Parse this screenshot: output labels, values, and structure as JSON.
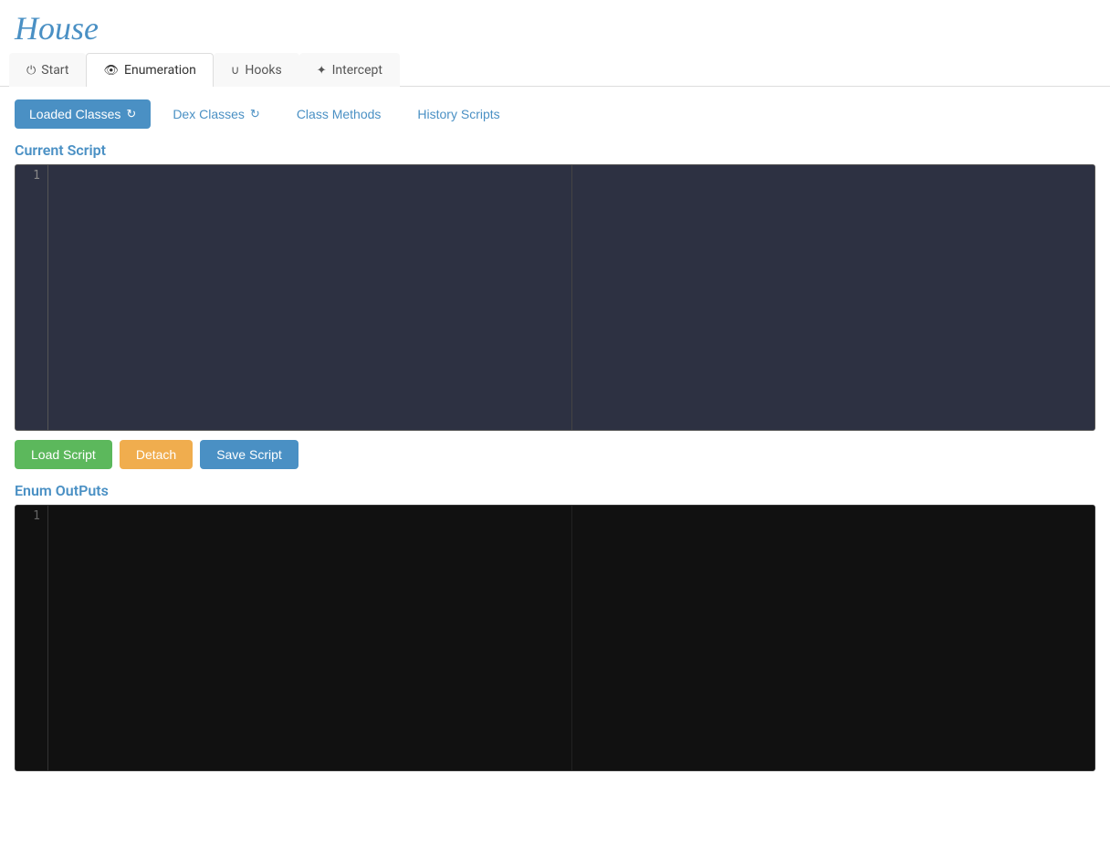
{
  "app": {
    "title": "House"
  },
  "nav": {
    "tabs": [
      {
        "id": "start",
        "label": "Start",
        "icon": "⏻",
        "active": false
      },
      {
        "id": "enumeration",
        "label": "Enumeration",
        "icon": "👁",
        "active": true
      },
      {
        "id": "hooks",
        "label": "Hooks",
        "icon": "Ʉ",
        "active": false
      },
      {
        "id": "intercept",
        "label": "Intercept",
        "icon": "✦",
        "active": false
      }
    ]
  },
  "sub_tabs": {
    "tabs": [
      {
        "id": "loaded-classes",
        "label": "Loaded Classes",
        "icon": "↻",
        "active": true
      },
      {
        "id": "dex-classes",
        "label": "Dex Classes",
        "icon": "↻",
        "active": false
      },
      {
        "id": "class-methods",
        "label": "Class Methods",
        "active": false
      },
      {
        "id": "history-scripts",
        "label": "History Scripts",
        "active": false
      }
    ]
  },
  "current_script": {
    "label": "Current Script",
    "line_number": "1"
  },
  "buttons": {
    "load_script": "Load Script",
    "detach": "Detach",
    "save_script": "Save Script"
  },
  "enum_outputs": {
    "label": "Enum OutPuts",
    "line_number": "1"
  }
}
